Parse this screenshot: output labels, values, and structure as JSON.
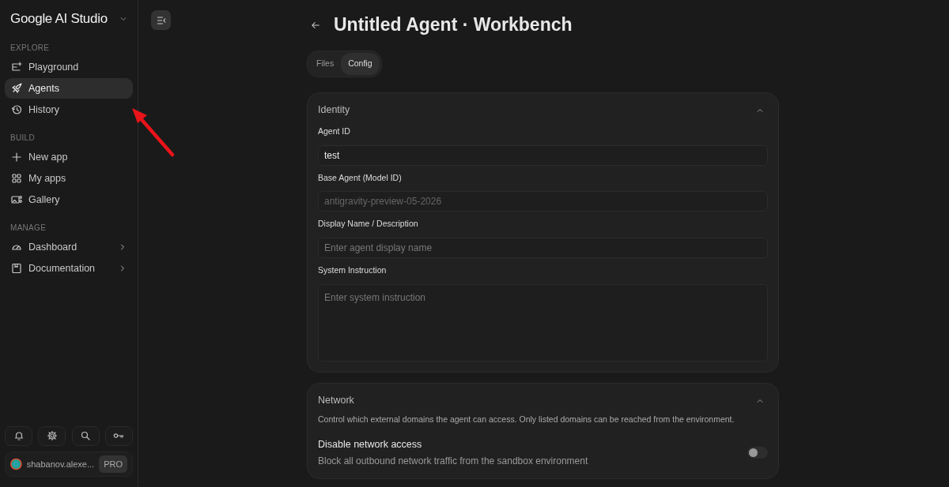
{
  "sidebar": {
    "brand": "Google AI Studio",
    "sections": [
      {
        "heading": "EXPLORE",
        "items": [
          {
            "label": "Playground",
            "selected": false,
            "has_submenu": false
          },
          {
            "label": "Agents",
            "selected": true,
            "has_submenu": false
          },
          {
            "label": "History",
            "selected": false,
            "has_submenu": false
          }
        ]
      },
      {
        "heading": "BUILD",
        "items": [
          {
            "label": "New app",
            "selected": false,
            "has_submenu": false
          },
          {
            "label": "My apps",
            "selected": false,
            "has_submenu": false
          },
          {
            "label": "Gallery",
            "selected": false,
            "has_submenu": false
          }
        ]
      },
      {
        "heading": "MANAGE",
        "items": [
          {
            "label": "Dashboard",
            "selected": false,
            "has_submenu": true
          },
          {
            "label": "Documentation",
            "selected": false,
            "has_submenu": true
          }
        ]
      }
    ],
    "user": {
      "name": "shabanov.alexe...",
      "badge": "PRO"
    }
  },
  "page": {
    "title": "Untitled Agent · Workbench",
    "tabs": [
      {
        "label": "Files",
        "selected": false
      },
      {
        "label": "Config",
        "selected": true
      }
    ],
    "sections": [
      {
        "title": "Identity",
        "expanded": true,
        "fields": [
          {
            "label": "Agent ID",
            "kind": "input",
            "value": "test",
            "disabled": false
          },
          {
            "label": "Base Agent (Model ID)",
            "kind": "input",
            "value": "antigravity-preview-05-2026",
            "disabled": true
          },
          {
            "label": "Display Name / Description",
            "kind": "input",
            "placeholder": "Enter agent display name",
            "disabled": false
          },
          {
            "label": "System Instruction",
            "kind": "textarea",
            "placeholder": "Enter system instruction",
            "disabled": false
          }
        ]
      },
      {
        "title": "Network",
        "expanded": true,
        "description": "Control which external domains the agent can access. Only listed domains can be reached from the environment.",
        "settings": [
          {
            "label": "Disable network access",
            "description": "Block all outbound network traffic from the sandbox environment",
            "on": false
          }
        ]
      }
    ]
  }
}
